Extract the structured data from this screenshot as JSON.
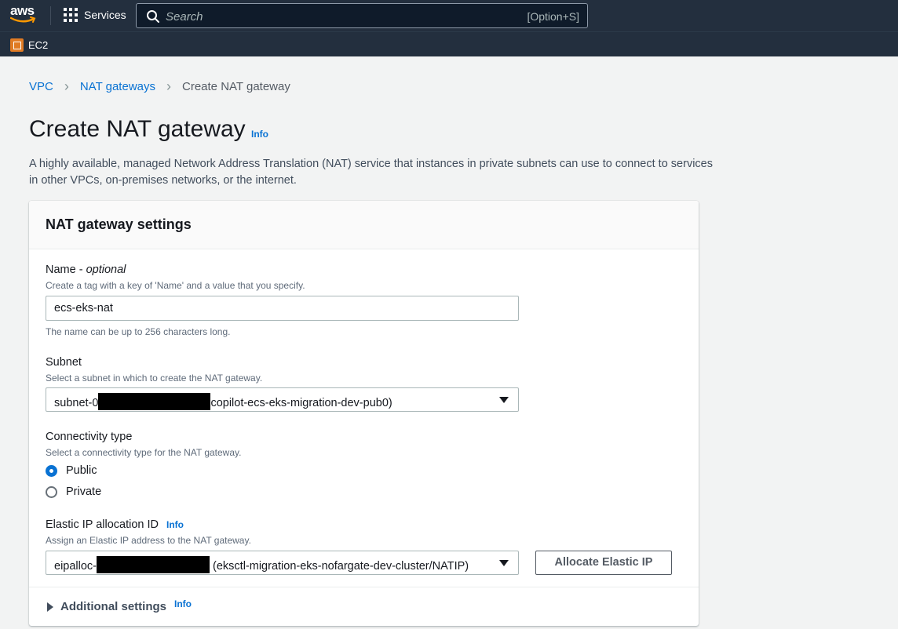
{
  "topnav": {
    "logo_text": "aws",
    "services_label": "Services",
    "search_placeholder": "Search",
    "search_shortcut": "[Option+S]"
  },
  "subnav": {
    "service_label": "EC2"
  },
  "breadcrumb": {
    "items": [
      "VPC",
      "NAT gateways"
    ],
    "current": "Create NAT gateway"
  },
  "page": {
    "title": "Create NAT gateway",
    "info_link": "Info",
    "description": "A highly available, managed Network Address Translation (NAT) service that instances in private subnets can use to connect to services in other VPCs, on-premises networks, or the internet."
  },
  "panel": {
    "header": "NAT gateway settings",
    "name": {
      "label": "Name - ",
      "label_optional": "optional",
      "hint": "Create a tag with a key of 'Name' and a value that you specify.",
      "value": "ecs-eks-nat",
      "constraint": "The name can be up to 256 characters long."
    },
    "subnet": {
      "label": "Subnet",
      "hint": "Select a subnet in which to create the NAT gateway.",
      "value_prefix": "subnet-0",
      "value_suffix": "copilot-ecs-eks-migration-dev-pub0)"
    },
    "connectivity": {
      "label": "Connectivity type",
      "hint": "Select a connectivity type for the NAT gateway.",
      "options": [
        "Public",
        "Private"
      ],
      "selected": "Public"
    },
    "elastic_ip": {
      "label": "Elastic IP allocation ID",
      "info_link": "Info",
      "hint": "Assign an Elastic IP address to the NAT gateway.",
      "value_prefix": "eipalloc-",
      "value_suffix": " (eksctl-migration-eks-nofargate-dev-cluster/NATIP)",
      "allocate_button": "Allocate Elastic IP"
    },
    "additional": {
      "label": "Additional settings",
      "info_link": "Info"
    }
  },
  "colors": {
    "nav_bg": "#232f3e",
    "link": "#0972d3",
    "ec2_orange": "#e07b24",
    "page_bg": "#f2f3f3"
  },
  "icons": [
    "grid-icon",
    "search-icon",
    "ec2-icon",
    "chevron-right-icon",
    "caret-down-icon",
    "caret-right-icon"
  ]
}
